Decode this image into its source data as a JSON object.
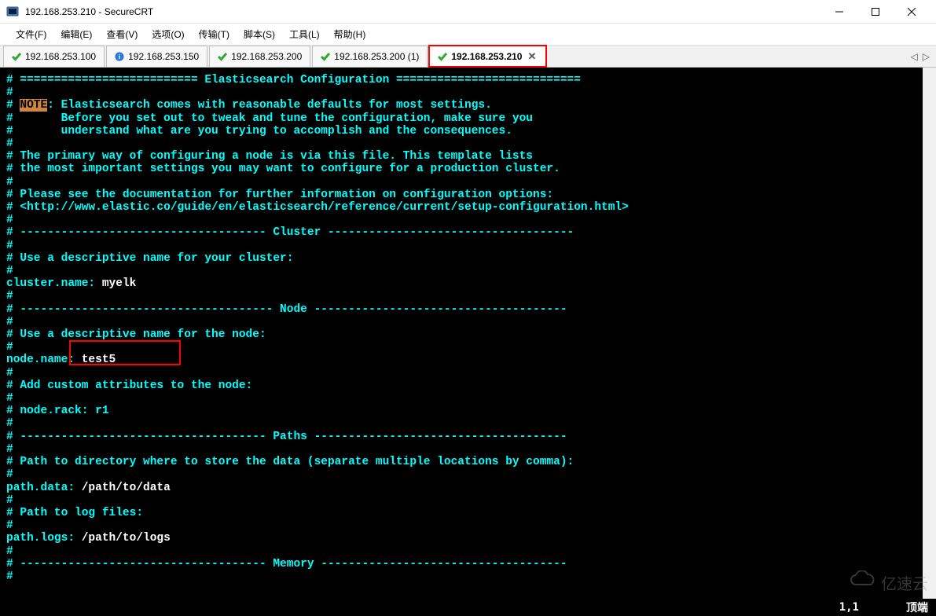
{
  "window": {
    "title": "192.168.253.210 - SecureCRT",
    "app_name": "SecureCRT"
  },
  "menu": {
    "items": [
      "文件(F)",
      "编辑(E)",
      "查看(V)",
      "选项(O)",
      "传输(T)",
      "脚本(S)",
      "工具(L)",
      "帮助(H)"
    ]
  },
  "tabs": [
    {
      "label": "192.168.253.100",
      "icon": "check",
      "active": false
    },
    {
      "label": "192.168.253.150",
      "icon": "info",
      "active": false
    },
    {
      "label": "192.168.253.200",
      "icon": "check",
      "active": false
    },
    {
      "label": "192.168.253.200 (1)",
      "icon": "check",
      "active": false
    },
    {
      "label": "192.168.253.210",
      "icon": "check",
      "active": true,
      "highlighted": true
    }
  ],
  "terminal": {
    "header_title": "Elasticsearch Configuration",
    "note_label": "NOTE",
    "note_lines": [
      "Elasticsearch comes with reasonable defaults for most settings.",
      "Before you set out to tweak and tune the configuration, make sure you",
      "understand what are you trying to accomplish and the consequences."
    ],
    "primary_lines": [
      "The primary way of configuring a node is via this file. This template lists",
      "the most important settings you may want to configure for a production cluster."
    ],
    "doc_lines": [
      "Please see the documentation for further information on configuration options:",
      "<http://www.elastic.co/guide/en/elasticsearch/reference/current/setup-configuration.html>"
    ],
    "section_cluster": "Cluster",
    "cluster_desc": "Use a descriptive name for your cluster:",
    "cluster_key": "cluster.name:",
    "cluster_val": "myelk",
    "section_node": "Node",
    "node_desc": "Use a descriptive name for the node:",
    "node_key": "node.name:",
    "node_val": "test5",
    "attr_desc": "Add custom attributes to the node:",
    "attr_key": "node.rack:",
    "attr_val": "r1",
    "section_paths": "Paths",
    "path_desc": "Path to directory where to store the data (separate multiple locations by comma):",
    "path_key": "path.data:",
    "path_val": "/path/to/data",
    "log_desc": "Path to log files:",
    "log_key": "path.logs:",
    "log_val": "/path/to/logs",
    "section_memory": "Memory"
  },
  "status": {
    "position": "1,1",
    "mode": "顶端"
  },
  "watermark": "亿速云"
}
